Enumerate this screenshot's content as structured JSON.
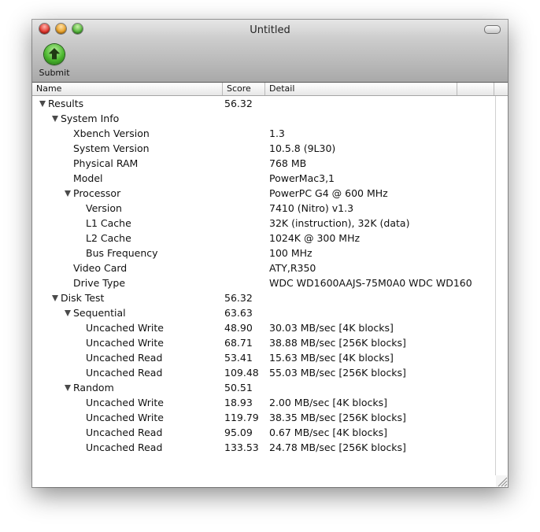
{
  "window": {
    "title": "Untitled"
  },
  "toolbar": {
    "submit_label": "Submit",
    "submit_icon": "up-arrow-icon"
  },
  "columns": {
    "name": "Name",
    "score": "Score",
    "detail": "Detail"
  },
  "rows": [
    {
      "label": "Results",
      "score": "56.32",
      "detail": "",
      "level": 0,
      "expandable": true
    },
    {
      "label": "System Info",
      "score": "",
      "detail": "",
      "level": 1,
      "expandable": true
    },
    {
      "label": "Xbench Version",
      "score": "",
      "detail": "1.3",
      "level": 2,
      "expandable": false
    },
    {
      "label": "System Version",
      "score": "",
      "detail": "10.5.8 (9L30)",
      "level": 2,
      "expandable": false
    },
    {
      "label": "Physical RAM",
      "score": "",
      "detail": "768 MB",
      "level": 2,
      "expandable": false
    },
    {
      "label": "Model",
      "score": "",
      "detail": "PowerMac3,1",
      "level": 2,
      "expandable": false
    },
    {
      "label": "Processor",
      "score": "",
      "detail": "PowerPC G4 @ 600 MHz",
      "level": 2,
      "expandable": true
    },
    {
      "label": "Version",
      "score": "",
      "detail": "7410 (Nitro) v1.3",
      "level": 3,
      "expandable": false
    },
    {
      "label": "L1 Cache",
      "score": "",
      "detail": "32K (instruction), 32K (data)",
      "level": 3,
      "expandable": false
    },
    {
      "label": "L2 Cache",
      "score": "",
      "detail": "1024K @ 300 MHz",
      "level": 3,
      "expandable": false
    },
    {
      "label": "Bus Frequency",
      "score": "",
      "detail": "100 MHz",
      "level": 3,
      "expandable": false
    },
    {
      "label": "Video Card",
      "score": "",
      "detail": "ATY,R350",
      "level": 2,
      "expandable": false
    },
    {
      "label": "Drive Type",
      "score": "",
      "detail": "WDC WD1600AAJS-75M0A0 WDC WD160",
      "level": 2,
      "expandable": false
    },
    {
      "label": "Disk Test",
      "score": "56.32",
      "detail": "",
      "level": 1,
      "expandable": true
    },
    {
      "label": "Sequential",
      "score": "63.63",
      "detail": "",
      "level": 2,
      "expandable": true
    },
    {
      "label": "Uncached Write",
      "score": "48.90",
      "detail": "30.03 MB/sec [4K blocks]",
      "level": 3,
      "expandable": false
    },
    {
      "label": "Uncached Write",
      "score": "68.71",
      "detail": "38.88 MB/sec [256K blocks]",
      "level": 3,
      "expandable": false
    },
    {
      "label": "Uncached Read",
      "score": "53.41",
      "detail": "15.63 MB/sec [4K blocks]",
      "level": 3,
      "expandable": false
    },
    {
      "label": "Uncached Read",
      "score": "109.48",
      "detail": "55.03 MB/sec [256K blocks]",
      "level": 3,
      "expandable": false
    },
    {
      "label": "Random",
      "score": "50.51",
      "detail": "",
      "level": 2,
      "expandable": true
    },
    {
      "label": "Uncached Write",
      "score": "18.93",
      "detail": "2.00 MB/sec [4K blocks]",
      "level": 3,
      "expandable": false
    },
    {
      "label": "Uncached Write",
      "score": "119.79",
      "detail": "38.35 MB/sec [256K blocks]",
      "level": 3,
      "expandable": false
    },
    {
      "label": "Uncached Read",
      "score": "95.09",
      "detail": "0.67 MB/sec [4K blocks]",
      "level": 3,
      "expandable": false
    },
    {
      "label": "Uncached Read",
      "score": "133.53",
      "detail": "24.78 MB/sec [256K blocks]",
      "level": 3,
      "expandable": false
    }
  ]
}
